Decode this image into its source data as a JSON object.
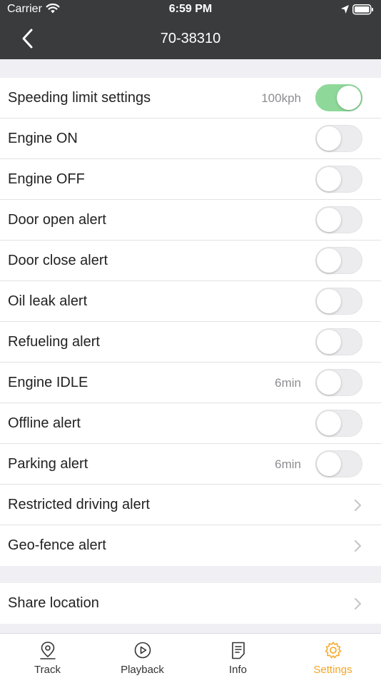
{
  "status_bar": {
    "carrier": "Carrier",
    "time": "6:59 PM"
  },
  "nav": {
    "title": "70-38310"
  },
  "settings": [
    {
      "label": "Speeding limit settings",
      "value": "100kph",
      "control": "toggle",
      "on": true
    },
    {
      "label": "Engine ON",
      "value": "",
      "control": "toggle",
      "on": false
    },
    {
      "label": "Engine OFF",
      "value": "",
      "control": "toggle",
      "on": false
    },
    {
      "label": "Door open alert",
      "value": "",
      "control": "toggle",
      "on": false
    },
    {
      "label": "Door close alert",
      "value": "",
      "control": "toggle",
      "on": false
    },
    {
      "label": "Oil leak alert",
      "value": "",
      "control": "toggle",
      "on": false
    },
    {
      "label": "Refueling alert",
      "value": "",
      "control": "toggle",
      "on": false
    },
    {
      "label": "Engine IDLE",
      "value": "6min",
      "control": "toggle",
      "on": false
    },
    {
      "label": "Offline alert",
      "value": "",
      "control": "toggle",
      "on": false
    },
    {
      "label": "Parking alert",
      "value": "6min",
      "control": "toggle",
      "on": false
    },
    {
      "label": "Restricted driving alert",
      "value": "",
      "control": "chevron"
    },
    {
      "label": "Geo-fence alert",
      "value": "",
      "control": "chevron"
    }
  ],
  "share": {
    "label": "Share location"
  },
  "tabs": [
    {
      "label": "Track",
      "icon": "map-pin-icon"
    },
    {
      "label": "Playback",
      "icon": "play-circle-icon"
    },
    {
      "label": "Info",
      "icon": "document-icon"
    },
    {
      "label": "Settings",
      "icon": "gear-icon",
      "active": true
    }
  ],
  "colors": {
    "header": "#3a3b3d",
    "toggle_on": "#8ed99a",
    "accent": "#f5a623"
  }
}
